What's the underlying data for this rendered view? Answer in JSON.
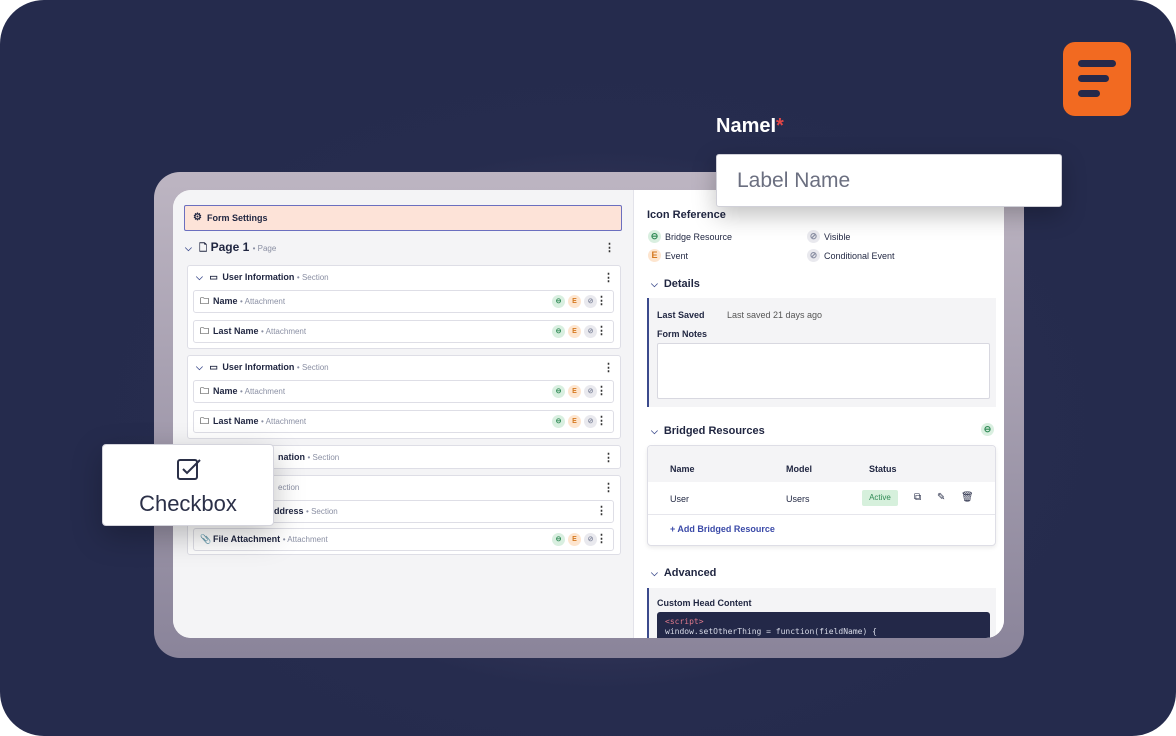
{
  "name_field": {
    "label": "NameI",
    "required_mark": "*",
    "placeholder": "Label Name"
  },
  "checkbox_card": {
    "label": "Checkbox",
    "icon": "checkbox-icon"
  },
  "left_panel": {
    "form_settings": "Form Settings",
    "page": {
      "title": "Page 1",
      "type": "Page"
    },
    "sections": [
      {
        "title": "User Information",
        "type": "Section",
        "fields": [
          {
            "name": "Name",
            "type": "Attachment"
          },
          {
            "name": "Last Name",
            "type": "Attachment"
          }
        ]
      },
      {
        "title": "User Information",
        "type": "Section",
        "fields": [
          {
            "name": "Name",
            "type": "Attachment"
          },
          {
            "name": "Last Name",
            "type": "Attachment"
          }
        ]
      },
      {
        "title": "nation",
        "type": "Section"
      },
      {
        "title": "ection",
        "sub_title": "ddress",
        "sub_type": "Section",
        "fields": [
          {
            "name": "File Attachment",
            "type": "Attachment"
          }
        ]
      }
    ],
    "badge_labels": {
      "event": "E"
    }
  },
  "right_panel": {
    "icon_reference": {
      "title": "Icon Reference",
      "items": [
        "Bridge Resource",
        "Visible",
        "Event",
        "Conditional Event"
      ],
      "event_letter": "E"
    },
    "details": {
      "title": "Details",
      "last_saved_label": "Last Saved",
      "last_saved_value": "Last saved 21 days ago",
      "form_notes_label": "Form Notes"
    },
    "bridged": {
      "title": "Bridged Resources",
      "columns": [
        "Name",
        "Model",
        "Status"
      ],
      "row": {
        "name": "User",
        "model": "Users",
        "status": "Active"
      },
      "add_label": "+ Add Bridged Resource"
    },
    "advanced": {
      "title": "Advanced",
      "custom_head_label": "Custom Head Content",
      "code_line1": "<script>",
      "code_line2": "window.setOtherThing = function(fieldName) {"
    }
  },
  "colors": {
    "background": "#262c4e",
    "logo": "#f26a21",
    "accent": "#3b4a8c",
    "form_settings_bg": "#fde3d8",
    "active_green": "#2f8a55",
    "required_red": "#e04646"
  }
}
